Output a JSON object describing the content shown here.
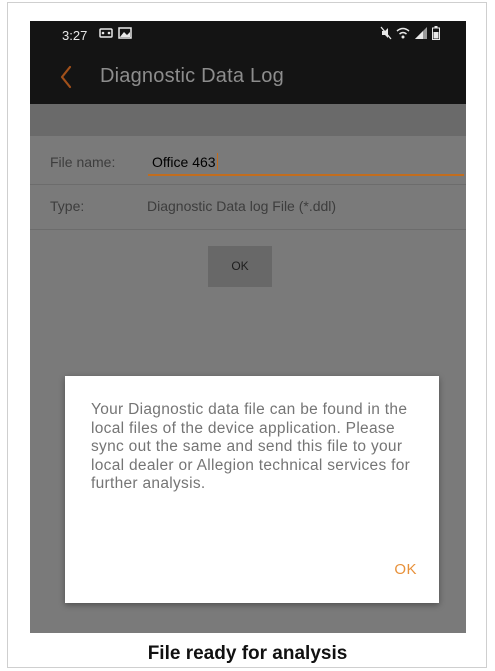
{
  "status_bar": {
    "time": "3:27",
    "left_icons": [
      "notification-icon",
      "image-icon"
    ],
    "right_icons": [
      "mute-icon",
      "wifi-icon",
      "signal-icon",
      "battery-icon"
    ]
  },
  "app_bar": {
    "back_icon": "chevron-left-icon",
    "title": "Diagnostic Data Log"
  },
  "form": {
    "file_name_label": "File name:",
    "file_name_value": "Office 463",
    "type_label": "Type:",
    "type_value": "Diagnostic Data log File (*.ddl)",
    "ok_label": "OK"
  },
  "dialog": {
    "message": "Your Diagnostic data file can be found in the local files of the device application. Please sync out the same and send this file to your local dealer or Allegion technical services for further analysis.",
    "ok_label": "OK"
  },
  "caption": "File ready for analysis",
  "colors": {
    "accent": "#e8913a",
    "app_bar": "#141414",
    "overlay_bg": "#7a7a7a"
  }
}
